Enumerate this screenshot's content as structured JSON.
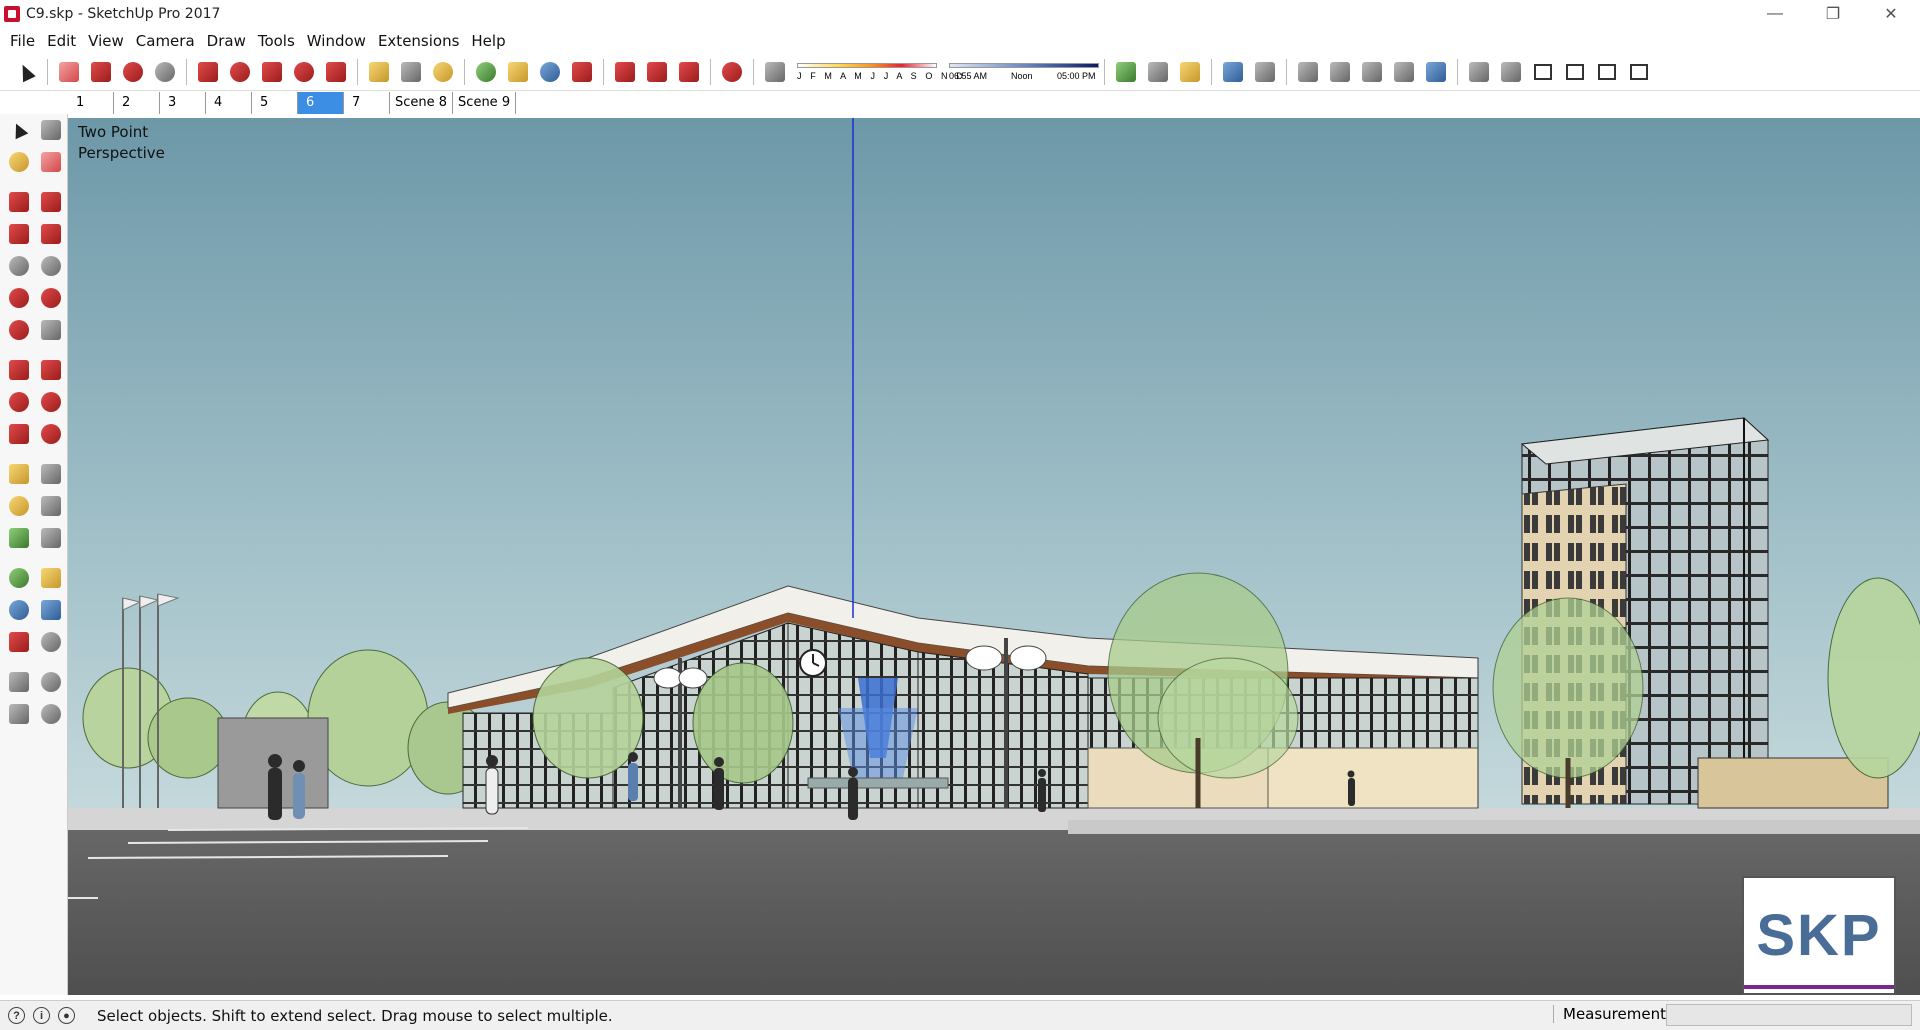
{
  "window": {
    "title": "C9.skp - SketchUp Pro 2017",
    "minimize": "—",
    "restore": "❐",
    "close": "✕"
  },
  "menu": [
    "File",
    "Edit",
    "View",
    "Camera",
    "Draw",
    "Tools",
    "Window",
    "Extensions",
    "Help"
  ],
  "shadows": {
    "months": "J F M A M J J A S O N D",
    "time_start": "06:55 AM",
    "time_mid": "Noon",
    "time_end": "05:00 PM"
  },
  "scenes": [
    {
      "label": "1",
      "active": false
    },
    {
      "label": "2",
      "active": false
    },
    {
      "label": "3",
      "active": false
    },
    {
      "label": "4",
      "active": false
    },
    {
      "label": "5",
      "active": false
    },
    {
      "label": "6",
      "active": true
    },
    {
      "label": "7",
      "active": false
    },
    {
      "label": "Scene 8",
      "active": false
    },
    {
      "label": "Scene 9",
      "active": false
    }
  ],
  "viewport": {
    "camera_label_line1": "Two Point",
    "camera_label_line2": "Perspective",
    "watermark": "SKP"
  },
  "status": {
    "hint": "Select objects. Shift to extend select. Drag mouse to select multiple.",
    "measurements_label": "Measurements",
    "measurements_value": ""
  },
  "colors": {
    "sky_top": "#6d98a8",
    "sky_bottom": "#c4d9dc",
    "ground": "#5b5b5b",
    "plaza": "#d9d9d9",
    "axis_blue": "#1a2fd6",
    "active_scene": "#3c8ee5"
  }
}
